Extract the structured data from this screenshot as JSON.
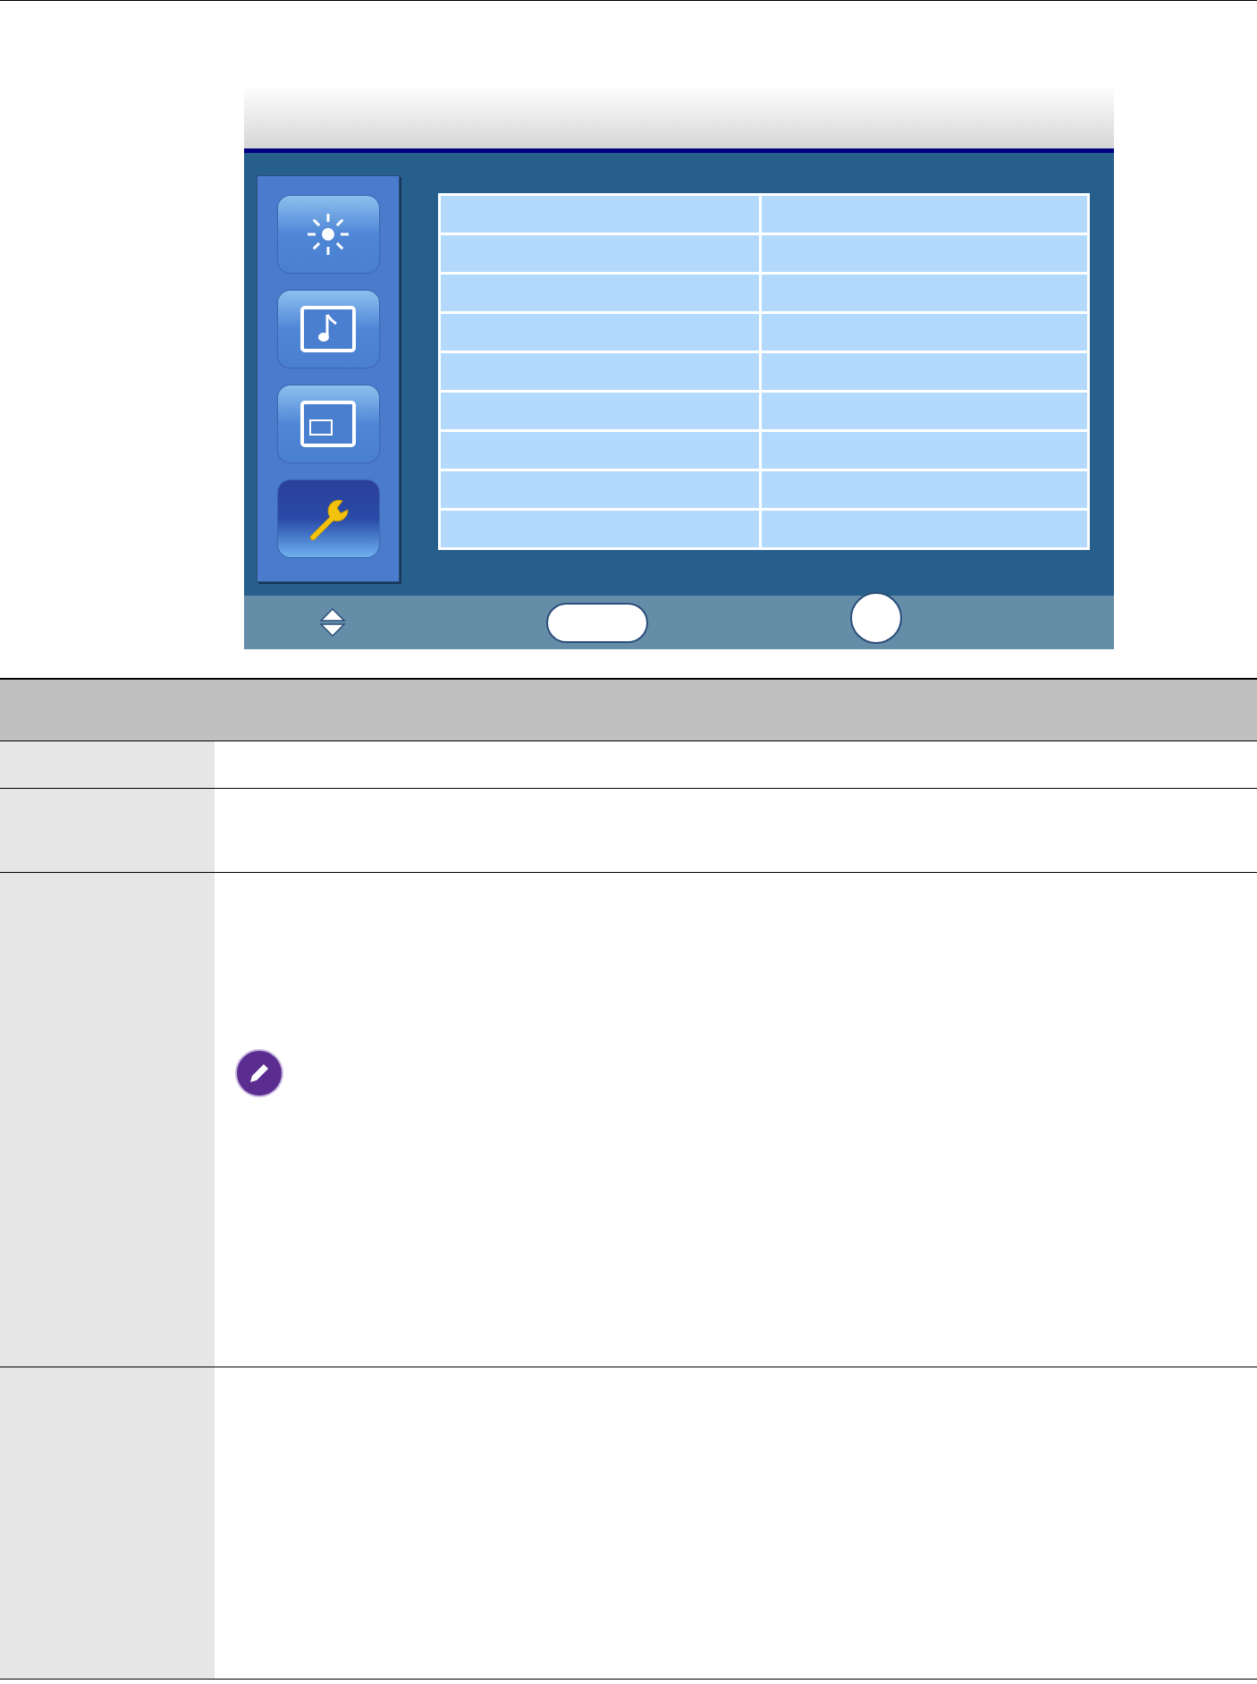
{
  "osd": {
    "menu": [
      {
        "kind": "brightness",
        "selected": false
      },
      {
        "kind": "audio",
        "selected": false
      },
      {
        "kind": "display",
        "selected": false
      },
      {
        "kind": "settings",
        "selected": true
      }
    ],
    "grid_rows": [
      {
        "kind": "empty"
      },
      {
        "kind": "empty"
      },
      {
        "kind": "empty"
      },
      {
        "kind": "empty"
      },
      {
        "kind": "empty"
      },
      {
        "kind": "empty"
      },
      {
        "kind": "empty"
      },
      {
        "kind": "empty"
      },
      {
        "kind": "empty"
      }
    ],
    "footer": [
      {
        "kind": "updown"
      },
      {
        "kind": "oval"
      },
      {
        "kind": "circle"
      }
    ]
  },
  "table": {
    "rows": [
      {
        "kind": "header"
      },
      {
        "kind": "short"
      },
      {
        "kind": "medium"
      },
      {
        "kind": "note"
      },
      {
        "kind": "tall"
      }
    ]
  }
}
